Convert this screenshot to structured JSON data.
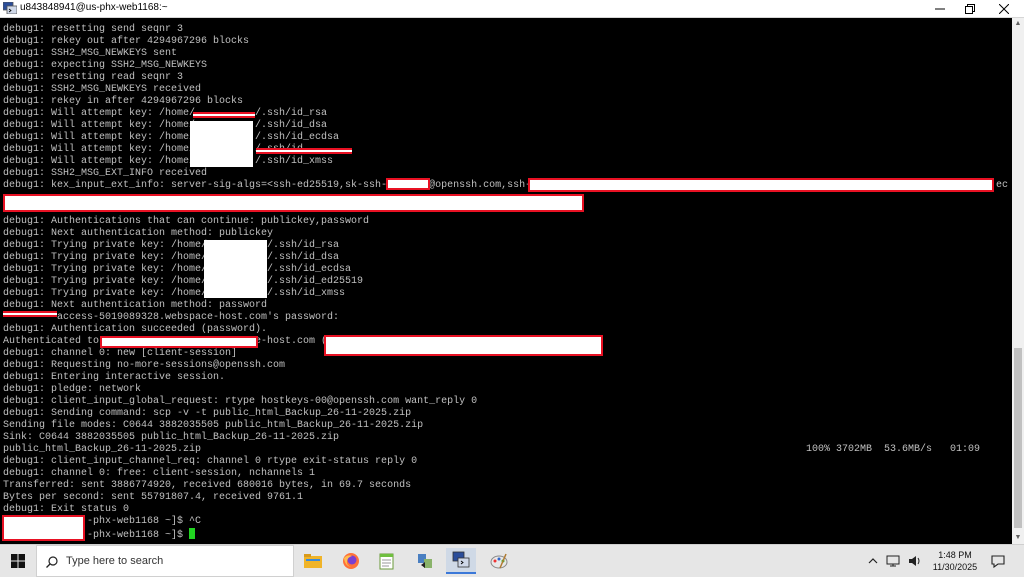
{
  "window": {
    "title": "u843848941@us-phx-web1168:~",
    "controls": [
      "minimize-icon",
      "maximize-icon",
      "close-icon"
    ]
  },
  "terminal": {
    "lines": [
      "debug1: resetting send seqnr 3",
      "debug1: rekey out after 4294967296 blocks",
      "debug1: SSH2_MSG_NEWKEYS sent",
      "debug1: expecting SSH2_MSG_NEWKEYS",
      "debug1: resetting read seqnr 3",
      "debug1: SSH2_MSG_NEWKEYS received",
      "debug1: rekey in after 4294967296 blocks",
      "debug1: Will attempt key: /home/          /.ssh/id_rsa",
      "debug1: Will attempt key: /home/          /.ssh/id_dsa",
      "debug1: Will attempt key: /home/          /.ssh/id_ecdsa",
      "debug1: Will attempt key: /home/          /.ssh/id_",
      "debug1: Will attempt key: /home/          /.ssh/id_xmss",
      "debug1: SSH2_MSG_EXT_INFO received",
      "debug1: kex_input_ext_info: server-sig-algs=<ssh-ed25519,sk-ssh-       @openssh.com,ssh-",
      "",
      "",
      "debug1: Authentications that can continue: publickey,password",
      "debug1: Next authentication method: publickey",
      "debug1: Trying private key: /home/          /.ssh/id_rsa",
      "debug1: Trying private key: /home/          /.ssh/id_dsa",
      "debug1: Trying private key: /home/          /.ssh/id_ecdsa",
      "debug1: Trying private key: /home/          /.ssh/id_ed25519",
      "debug1: Trying private key: /home/          /.ssh/id_xmss",
      "debug1: Next authentication method: password",
      "         access-5019089328.webspace-host.com's password:",
      "debug1: Authentication succeeded (password).",
      "Authenticated to                      space-host.com (",
      "debug1: channel 0: new [client-session]",
      "debug1: Requesting no-more-sessions@openssh.com",
      "debug1: Entering interactive session.",
      "debug1: pledge: network",
      "debug1: client_input_global_request: rtype hostkeys-00@openssh.com want_reply 0",
      "debug1: Sending command: scp -v -t public_html_Backup_26-11-2025.zip",
      "Sending file modes: C0644 3882035505 public_html_Backup_26-11-2025.zip",
      "Sink: C0644 3882035505 public_html_Backup_26-11-2025.zip",
      "public_html_Backup_26-11-2025.zip",
      "debug1: client_input_channel_req: channel 0 rtype exit-status reply 0",
      "debug1: channel 0: free: client-session, nchannels 1",
      "Transferred: sent 3886774920, received 680016 bytes, in 69.7 seconds",
      "Bytes per second: sent 55791807.4, received 9761.1",
      "debug1: Exit status 0",
      "              -phx-web1168 ~]$ ^C",
      "              -phx-web1168 ~]$ "
    ],
    "ec_suffix": "ec",
    "progress_text": "100% 3702MB  53.6MB/s   01:09",
    "progress_percent": 100,
    "cursor_color": "#21d421"
  },
  "taskbar": {
    "search_placeholder": "Type here to search",
    "apps": [
      "file-explorer-icon",
      "firefox-icon",
      "notepad-icon",
      "winscp-icon",
      "putty-icon",
      "paint-icon"
    ],
    "tray_icons": [
      "chevron-up-icon",
      "network-icon",
      "volume-icon"
    ],
    "time": "1:48 PM",
    "date": "11/30/2025",
    "notification_icon": "notification-icon"
  },
  "colors": {
    "terminal_bg": "#000000",
    "terminal_text": "#c0c0c0",
    "redaction_border": "#e81123",
    "taskbar_bg": "#e6e6e6"
  }
}
